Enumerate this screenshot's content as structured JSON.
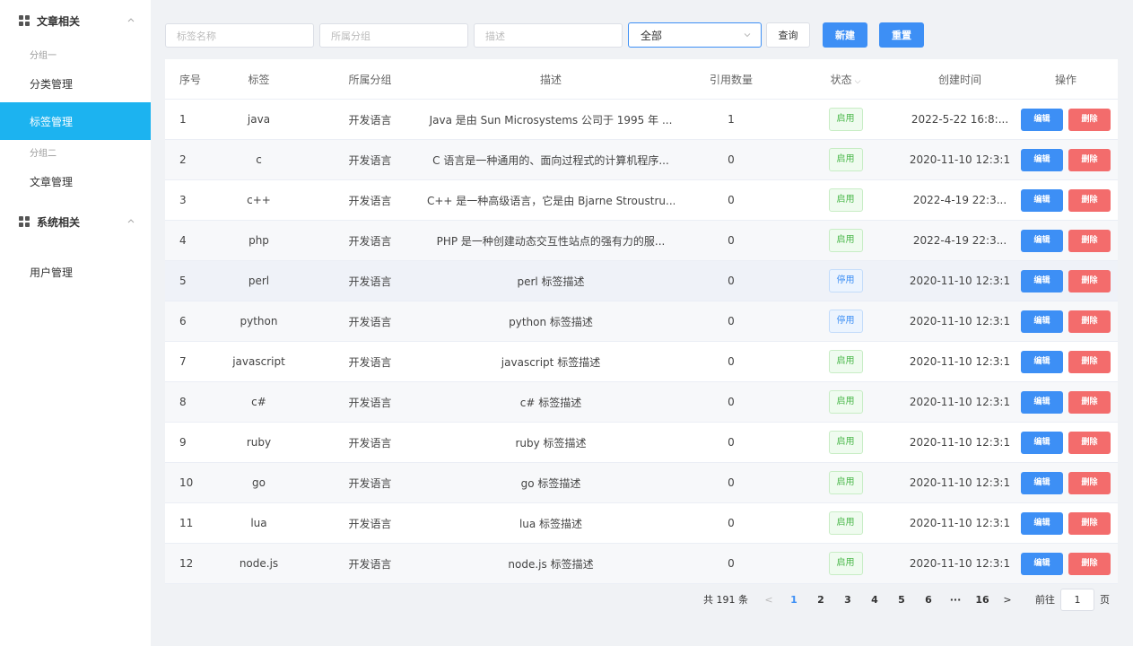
{
  "sidebar": {
    "groups": [
      {
        "label": "文章相关"
      },
      {
        "label": "系统相关"
      }
    ],
    "subheads": [
      "分组一",
      "分组二"
    ],
    "items": [
      {
        "label": "分类管理"
      },
      {
        "label": "标签管理"
      },
      {
        "label": "文章管理"
      },
      {
        "label": "用户管理"
      }
    ]
  },
  "toolbar": {
    "tag_name_placeholder": "标签名称",
    "group_placeholder": "所属分组",
    "desc_placeholder": "描述",
    "status_select_value": "全部",
    "query_label": "查询",
    "new_label": "新建",
    "reset_label": "重置"
  },
  "table": {
    "headers": [
      "序号",
      "标签",
      "所属分组",
      "描述",
      "引用数量",
      "状态",
      "创建时间",
      "操作"
    ],
    "edit_label": "编辑",
    "delete_label": "删除",
    "rows": [
      {
        "idx": "1",
        "tag": "java",
        "group": "开发语言",
        "desc": "Java 是由 Sun Microsystems 公司于 1995 年 ...",
        "count": "1",
        "status": "启用",
        "time": "2022-5-22 16:8:..."
      },
      {
        "idx": "2",
        "tag": "c",
        "group": "开发语言",
        "desc": "C 语言是一种通用的、面向过程式的计算机程序...",
        "count": "0",
        "status": "启用",
        "time": "2020-11-10 12:3:1"
      },
      {
        "idx": "3",
        "tag": "c++",
        "group": "开发语言",
        "desc": "C++ 是一种高级语言，它是由 Bjarne Stroustru...",
        "count": "0",
        "status": "启用",
        "time": "2022-4-19 22:3..."
      },
      {
        "idx": "4",
        "tag": "php",
        "group": "开发语言",
        "desc": "PHP 是一种创建动态交互性站点的强有力的服...",
        "count": "0",
        "status": "启用",
        "time": "2022-4-19 22:3..."
      },
      {
        "idx": "5",
        "tag": "perl",
        "group": "开发语言",
        "desc": "perl 标签描述",
        "count": "0",
        "status": "停用",
        "time": "2020-11-10 12:3:1"
      },
      {
        "idx": "6",
        "tag": "python",
        "group": "开发语言",
        "desc": "python 标签描述",
        "count": "0",
        "status": "停用",
        "time": "2020-11-10 12:3:1"
      },
      {
        "idx": "7",
        "tag": "javascript",
        "group": "开发语言",
        "desc": "javascript 标签描述",
        "count": "0",
        "status": "启用",
        "time": "2020-11-10 12:3:1"
      },
      {
        "idx": "8",
        "tag": "c#",
        "group": "开发语言",
        "desc": "c# 标签描述",
        "count": "0",
        "status": "启用",
        "time": "2020-11-10 12:3:1"
      },
      {
        "idx": "9",
        "tag": "ruby",
        "group": "开发语言",
        "desc": "ruby 标签描述",
        "count": "0",
        "status": "启用",
        "time": "2020-11-10 12:3:1"
      },
      {
        "idx": "10",
        "tag": "go",
        "group": "开发语言",
        "desc": "go 标签描述",
        "count": "0",
        "status": "启用",
        "time": "2020-11-10 12:3:1"
      },
      {
        "idx": "11",
        "tag": "lua",
        "group": "开发语言",
        "desc": "lua 标签描述",
        "count": "0",
        "status": "启用",
        "time": "2020-11-10 12:3:1"
      },
      {
        "idx": "12",
        "tag": "node.js",
        "group": "开发语言",
        "desc": "node.js 标签描述",
        "count": "0",
        "status": "启用",
        "time": "2020-11-10 12:3:1"
      }
    ]
  },
  "pagination": {
    "total_text": "共 191 条",
    "pages": [
      "1",
      "2",
      "3",
      "4",
      "5",
      "6",
      "···",
      "16"
    ],
    "current": "1",
    "goto_label": "前往",
    "goto_value": "1",
    "page_suffix": "页"
  },
  "colors": {
    "accent": "#1cb3f0",
    "primary": "#3d8ff5",
    "danger": "#f36c6c",
    "success": "#4bb84b"
  }
}
